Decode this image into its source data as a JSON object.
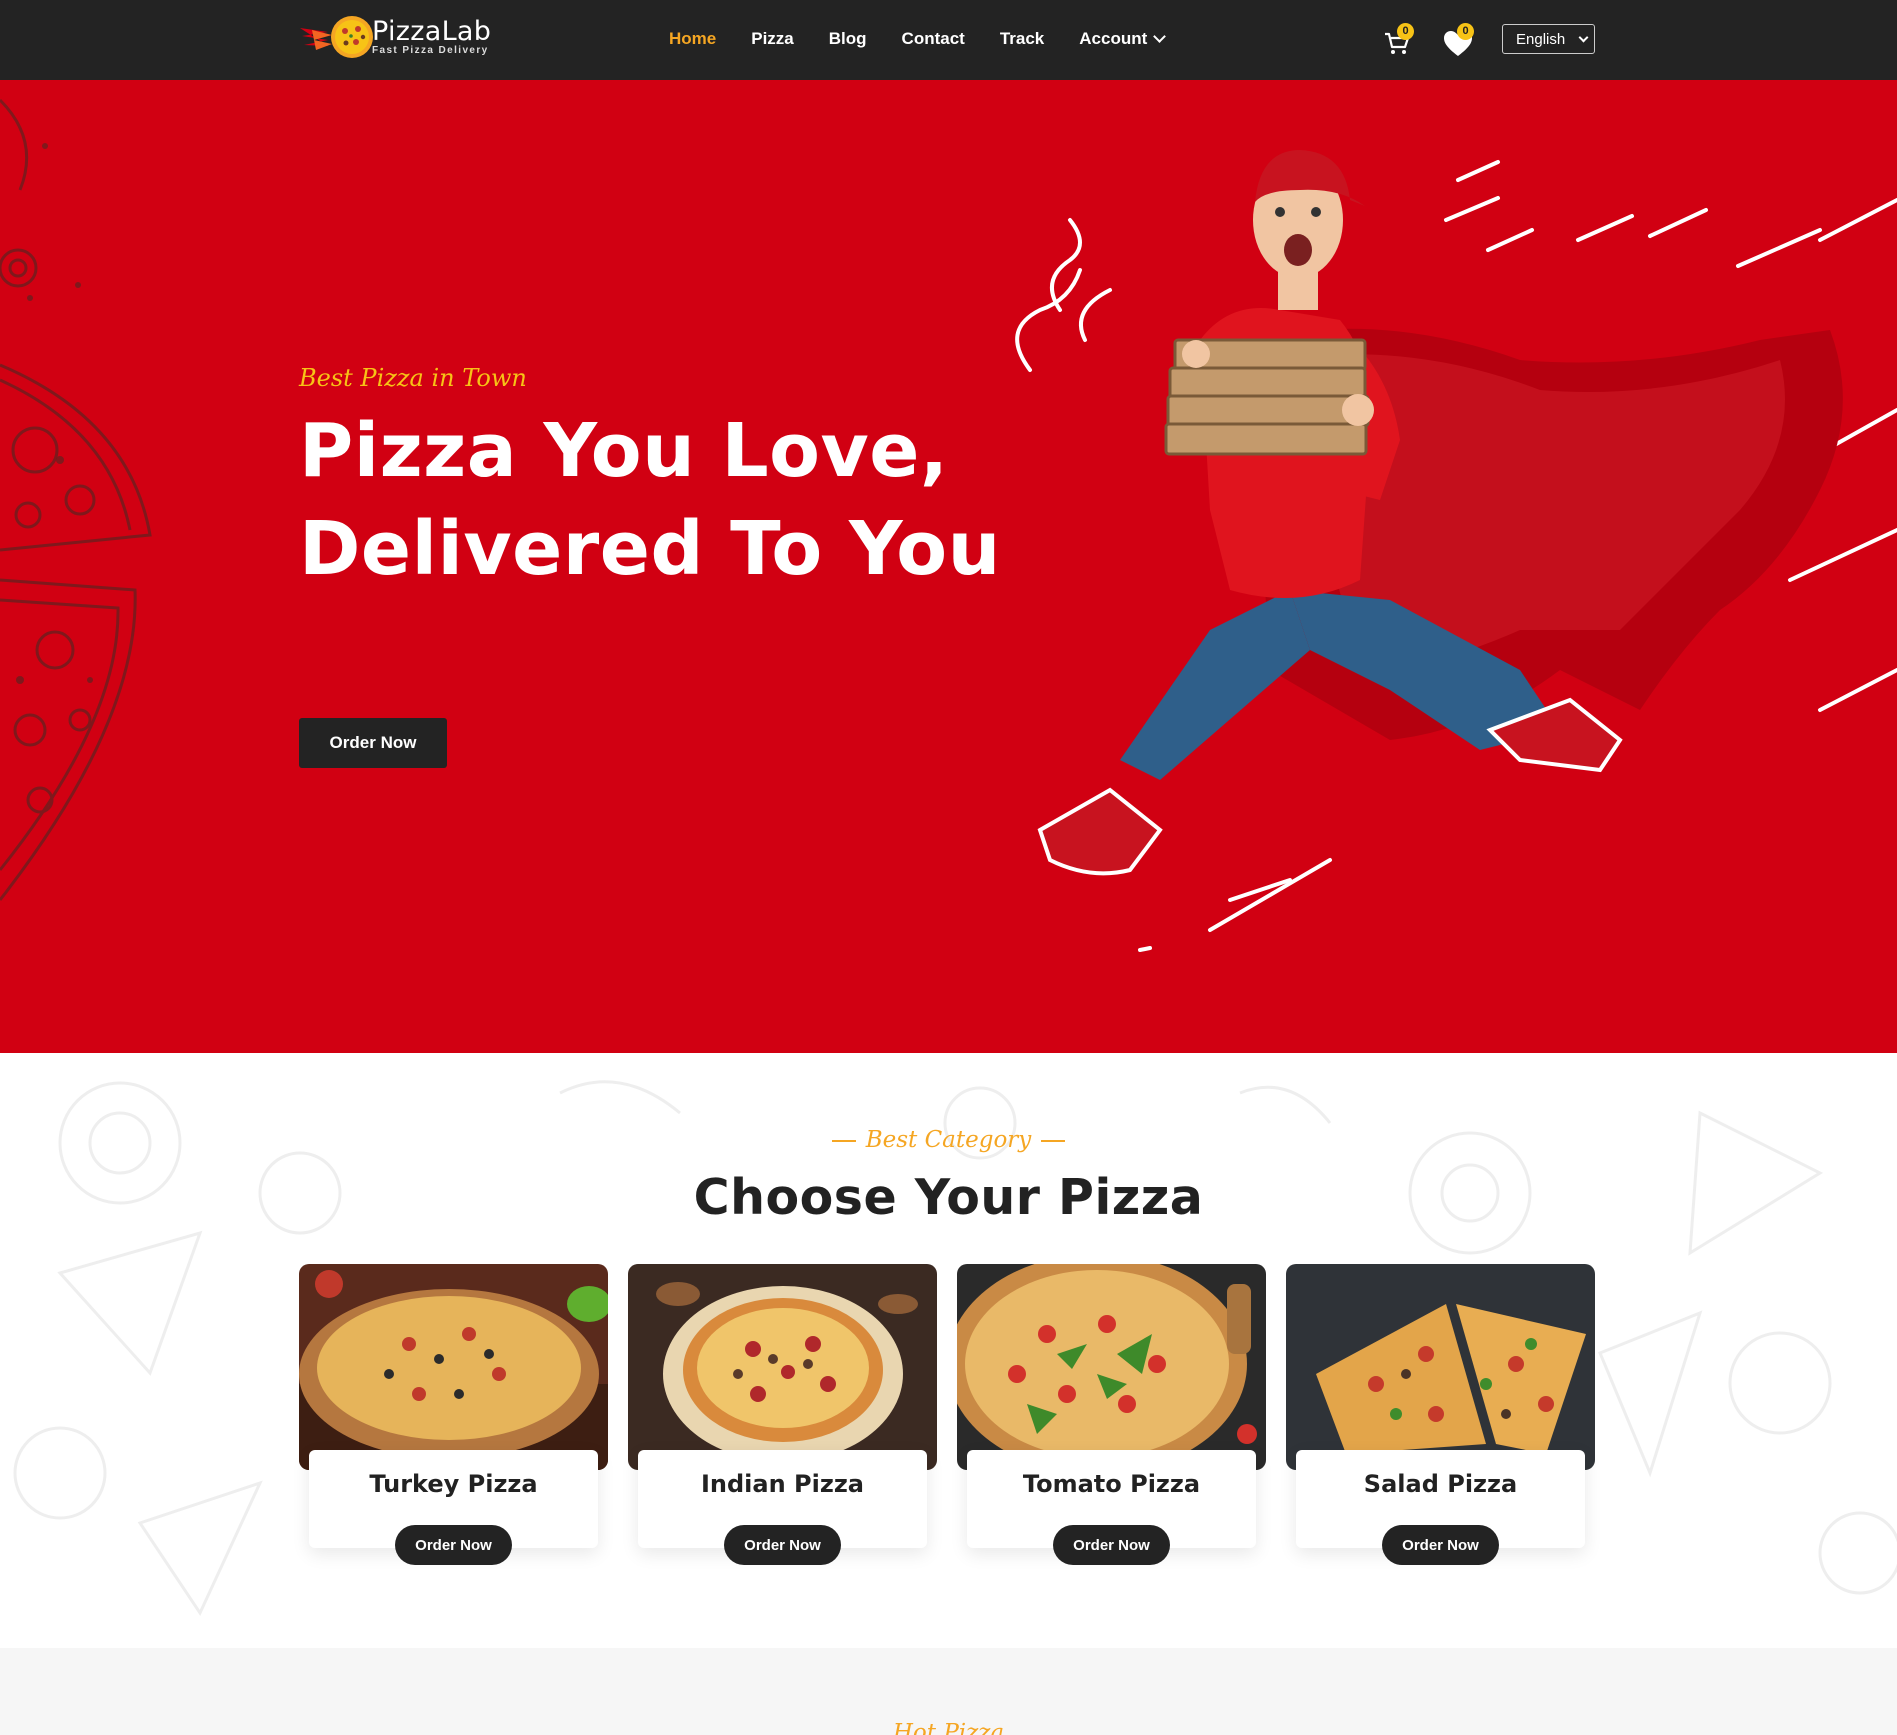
{
  "header": {
    "logo_name": "PizzaLab",
    "logo_tagline": "Fast Pizza Delivery",
    "nav": [
      {
        "label": "Home",
        "active": true
      },
      {
        "label": "Pizza"
      },
      {
        "label": "Blog"
      },
      {
        "label": "Contact"
      },
      {
        "label": "Track"
      },
      {
        "label": "Account"
      }
    ],
    "cart_count": "0",
    "wishlist_count": "0",
    "language": "English"
  },
  "hero": {
    "tagline": "Best Pizza in Town",
    "title": "Pizza You Love, Delivered To You",
    "cta": "Order Now"
  },
  "category": {
    "eyebrow": "Best Category",
    "title": "Choose Your Pizza",
    "cards": [
      {
        "name": "Turkey Pizza",
        "cta": "Order Now"
      },
      {
        "name": "Indian Pizza",
        "cta": "Order Now"
      },
      {
        "name": "Tomato Pizza",
        "cta": "Order Now"
      },
      {
        "name": "Salad Pizza",
        "cta": "Order Now"
      }
    ]
  },
  "next_section": {
    "eyebrow": "Hot Pizza"
  },
  "colors": {
    "header_bg": "#232323",
    "hero_bg": "#d10012",
    "accent": "#f5a623",
    "badge": "#f7c316"
  },
  "icons": [
    "pizza-logo-icon",
    "cart-icon",
    "heart-icon",
    "chevron-down-icon"
  ]
}
